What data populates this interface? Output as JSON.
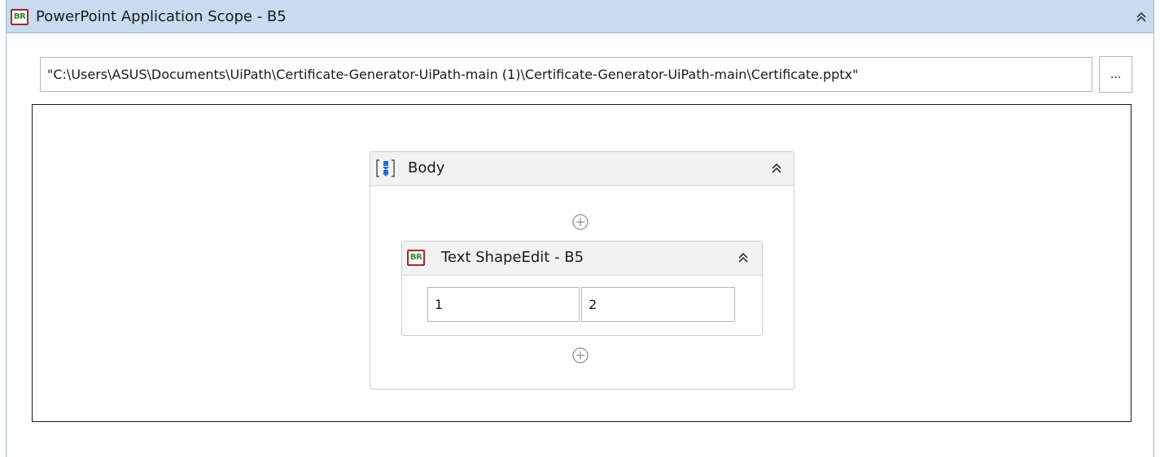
{
  "scope": {
    "icon": "br-icon",
    "icon_text": "BR",
    "title": "PowerPoint Application Scope - B5",
    "collapse_icon": "double-chevron-up-icon",
    "file_path": "\"C:\\Users\\ASUS\\Documents\\UiPath\\Certificate-Generator-UiPath-main (1)\\Certificate-Generator-UiPath-main\\Certificate.pptx\"",
    "browse_label": "..."
  },
  "body": {
    "icon": "sequence-icon",
    "title": "Body",
    "collapse_icon": "double-chevron-up-icon",
    "add_icon": "add-circle-icon"
  },
  "activity": {
    "icon": "br-icon",
    "icon_text": "BR",
    "title": "Text ShapeEdit - B5",
    "collapse_icon": "double-chevron-up-icon",
    "field_1": "1",
    "field_2": "2"
  },
  "colors": {
    "scope_header_bg": "#c7dcef",
    "br_icon_border": "#a9252b",
    "br_icon_text": "#2e8b2e",
    "sequence_icon": "#1e6fd9"
  }
}
